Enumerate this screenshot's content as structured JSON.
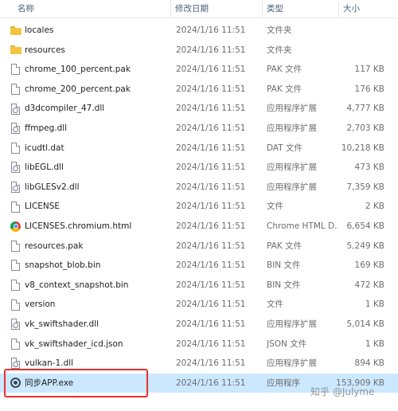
{
  "columns": {
    "name": "名称",
    "date": "修改日期",
    "type": "类型",
    "size": "大小"
  },
  "files": [
    {
      "icon": "folder-icon",
      "name": "locales",
      "date": "2024/1/16 11:51",
      "type": "文件夹",
      "size": ""
    },
    {
      "icon": "folder-icon",
      "name": "resources",
      "date": "2024/1/16 11:51",
      "type": "文件夹",
      "size": ""
    },
    {
      "icon": "file-icon",
      "name": "chrome_100_percent.pak",
      "date": "2024/1/16 11:51",
      "type": "PAK 文件",
      "size": "117 KB"
    },
    {
      "icon": "file-icon",
      "name": "chrome_200_percent.pak",
      "date": "2024/1/16 11:51",
      "type": "PAK 文件",
      "size": "176 KB"
    },
    {
      "icon": "dll-icon",
      "name": "d3dcompiler_47.dll",
      "date": "2024/1/16 11:51",
      "type": "应用程序扩展",
      "size": "4,777 KB"
    },
    {
      "icon": "dll-icon",
      "name": "ffmpeg.dll",
      "date": "2024/1/16 11:51",
      "type": "应用程序扩展",
      "size": "2,703 KB"
    },
    {
      "icon": "file-icon",
      "name": "icudtl.dat",
      "date": "2024/1/16 11:51",
      "type": "DAT 文件",
      "size": "10,218 KB"
    },
    {
      "icon": "dll-icon",
      "name": "libEGL.dll",
      "date": "2024/1/16 11:51",
      "type": "应用程序扩展",
      "size": "473 KB"
    },
    {
      "icon": "dll-icon",
      "name": "libGLESv2.dll",
      "date": "2024/1/16 11:51",
      "type": "应用程序扩展",
      "size": "7,359 KB"
    },
    {
      "icon": "file-icon",
      "name": "LICENSE",
      "date": "2024/1/16 11:51",
      "type": "文件",
      "size": "2 KB"
    },
    {
      "icon": "chrome-icon",
      "name": "LICENSES.chromium.html",
      "date": "2024/1/16 11:51",
      "type": "Chrome HTML D...",
      "size": "6,654 KB"
    },
    {
      "icon": "file-icon",
      "name": "resources.pak",
      "date": "2024/1/16 11:51",
      "type": "PAK 文件",
      "size": "5,249 KB"
    },
    {
      "icon": "file-icon",
      "name": "snapshot_blob.bin",
      "date": "2024/1/16 11:51",
      "type": "BIN 文件",
      "size": "169 KB"
    },
    {
      "icon": "file-icon",
      "name": "v8_context_snapshot.bin",
      "date": "2024/1/16 11:51",
      "type": "BIN 文件",
      "size": "472 KB"
    },
    {
      "icon": "file-icon",
      "name": "version",
      "date": "2024/1/16 11:51",
      "type": "文件",
      "size": "1 KB"
    },
    {
      "icon": "dll-icon",
      "name": "vk_swiftshader.dll",
      "date": "2024/1/16 11:51",
      "type": "应用程序扩展",
      "size": "5,014 KB"
    },
    {
      "icon": "file-icon",
      "name": "vk_swiftshader_icd.json",
      "date": "2024/1/16 11:51",
      "type": "JSON 文件",
      "size": "1 KB"
    },
    {
      "icon": "dll-icon",
      "name": "vulkan-1.dll",
      "date": "2024/1/16 11:51",
      "type": "应用程序扩展",
      "size": "894 KB"
    },
    {
      "icon": "app-icon",
      "name": "同步APP.exe",
      "date": "2024/1/16 11:51",
      "type": "应用程序",
      "size": "153,909 KB",
      "selected": true
    }
  ],
  "watermark": "知乎 @Julyme",
  "colors": {
    "selected_row": "#cce8ff",
    "highlight_border": "#e8312f",
    "folder": "#f4c542"
  }
}
